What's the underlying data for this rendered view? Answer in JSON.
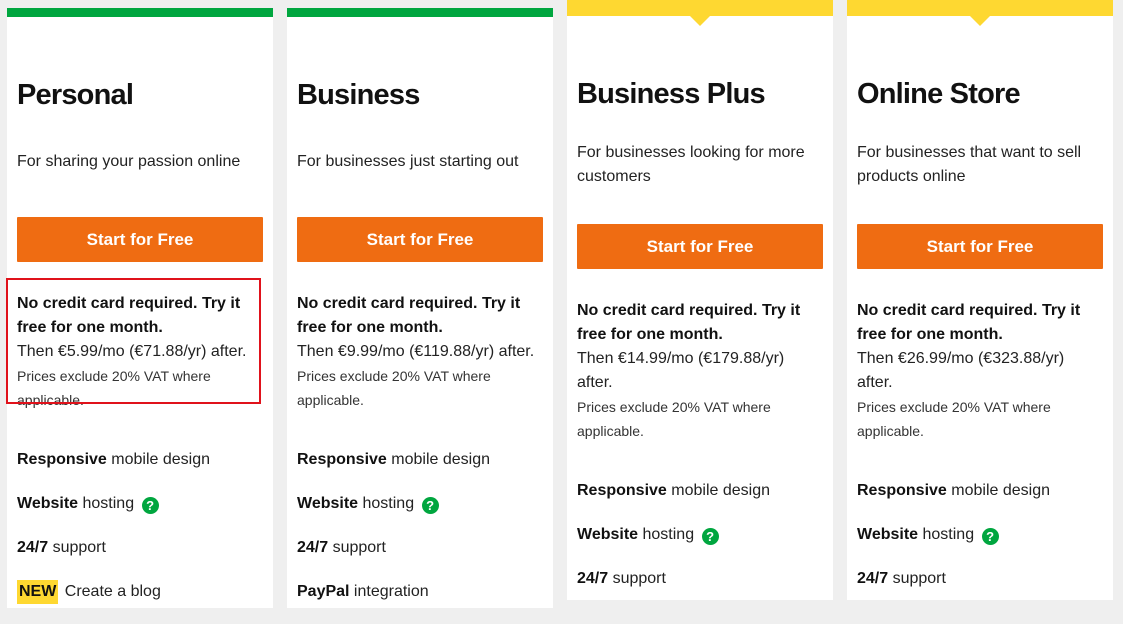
{
  "plans": [
    {
      "name": "Personal",
      "description": "For sharing your passion online",
      "cta": "Start for Free",
      "trial": "No credit card required. Try it free for one month.",
      "then": "Then €5.99/mo (€71.88/yr) after.",
      "vat": "Prices exclude 20% VAT where applicable.",
      "features": [
        {
          "bold": "Responsive",
          "text": " mobile design"
        },
        {
          "bold": "Website",
          "text": " hosting"
        },
        {
          "bold": "24/7",
          "text": " support"
        },
        {
          "badge": "NEW",
          "text": " Create a blog"
        }
      ]
    },
    {
      "name": "Business",
      "description": "For businesses just starting out",
      "cta": "Start for Free",
      "trial": "No credit card required. Try it free for one month.",
      "then": "Then €9.99/mo (€119.88/yr) after.",
      "vat": "Prices exclude 20% VAT where applicable.",
      "features": [
        {
          "bold": "Responsive",
          "text": " mobile design"
        },
        {
          "bold": "Website",
          "text": " hosting"
        },
        {
          "bold": "24/7",
          "text": " support"
        },
        {
          "bold": "PayPal",
          "text": " integration"
        }
      ]
    },
    {
      "name": "Business Plus",
      "description": "For businesses looking for more customers",
      "cta": "Start for Free",
      "trial": "No credit card required. Try it free for one month.",
      "then": "Then €14.99/mo (€179.88/yr) after.",
      "vat": "Prices exclude 20% VAT where applicable.",
      "features": [
        {
          "bold": "Responsive",
          "text": " mobile design"
        },
        {
          "bold": "Website",
          "text": " hosting"
        },
        {
          "bold": "24/7",
          "text": " support"
        }
      ]
    },
    {
      "name": "Online Store",
      "description": "For businesses that want to sell products online",
      "cta": "Start for Free",
      "trial": "No credit card required. Try it free for one month.",
      "then": "Then €26.99/mo (€323.88/yr) after.",
      "vat": "Prices exclude 20% VAT where applicable.",
      "features": [
        {
          "bold": "Responsive",
          "text": " mobile design"
        },
        {
          "bold": "Website",
          "text": " hosting"
        },
        {
          "bold": "24/7",
          "text": " support"
        }
      ]
    }
  ],
  "help_icon_glyph": "?",
  "colors": {
    "green": "#00a63f",
    "yellow": "#fed831",
    "orange_cta": "#ef6c12",
    "highlight_red": "#e0121b"
  }
}
